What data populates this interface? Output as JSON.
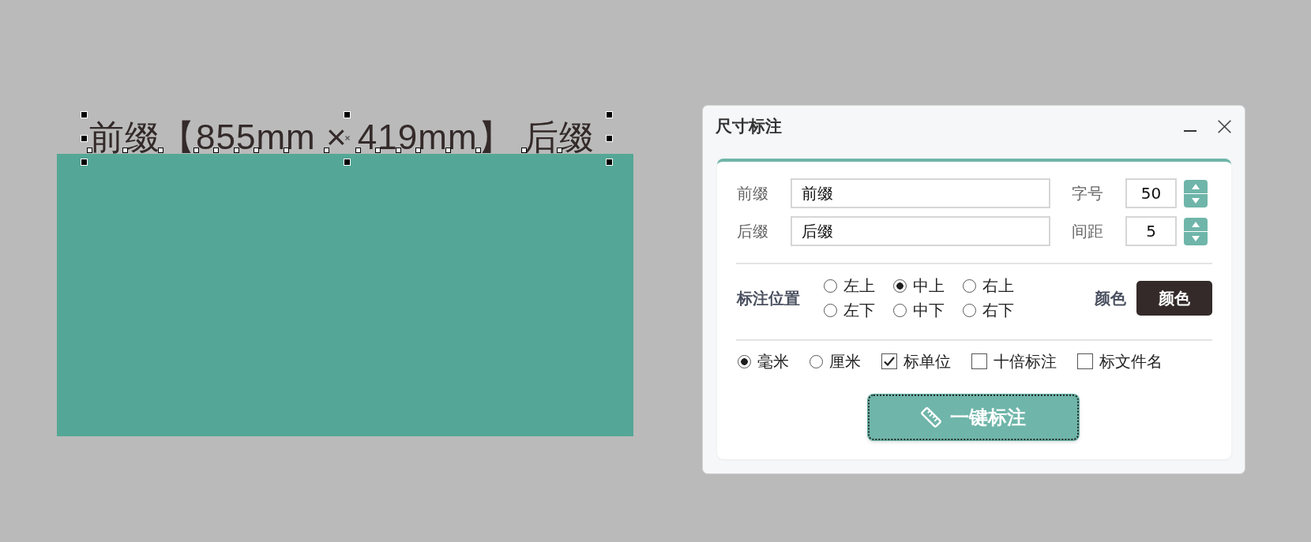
{
  "canvas": {
    "text_object": {
      "text": "前缀【855mm × 419mm】 后缀",
      "selected": true
    }
  },
  "dialog": {
    "title": "尺寸标注",
    "rows": [
      {
        "text_field": {
          "label": "前缀",
          "value": "前缀"
        },
        "number_field": {
          "label": "字号",
          "value": "50"
        }
      },
      {
        "text_field": {
          "label": "后缀",
          "value": "后缀"
        },
        "number_field": {
          "label": "间距",
          "value": "5"
        }
      }
    ],
    "position": {
      "label": "标注位置",
      "options": [
        {
          "label": "左上",
          "selected": false
        },
        {
          "label": "中上",
          "selected": true
        },
        {
          "label": "右上",
          "selected": false
        },
        {
          "label": "左下",
          "selected": false
        },
        {
          "label": "中下",
          "selected": false
        },
        {
          "label": "右下",
          "selected": false
        }
      ]
    },
    "color_picker": {
      "label": "颜色",
      "button": "颜色",
      "color": "#332a29"
    },
    "options": [
      {
        "kind": "radio",
        "label": "毫米",
        "selected": true
      },
      {
        "kind": "radio",
        "label": "厘米",
        "selected": false
      },
      {
        "kind": "checkbox",
        "label": "标单位",
        "checked": true
      },
      {
        "kind": "checkbox",
        "label": "十倍标注",
        "checked": false
      },
      {
        "kind": "checkbox",
        "label": "标文件名",
        "checked": false
      }
    ],
    "action_button": {
      "label": "一键标注",
      "focused": true
    }
  }
}
